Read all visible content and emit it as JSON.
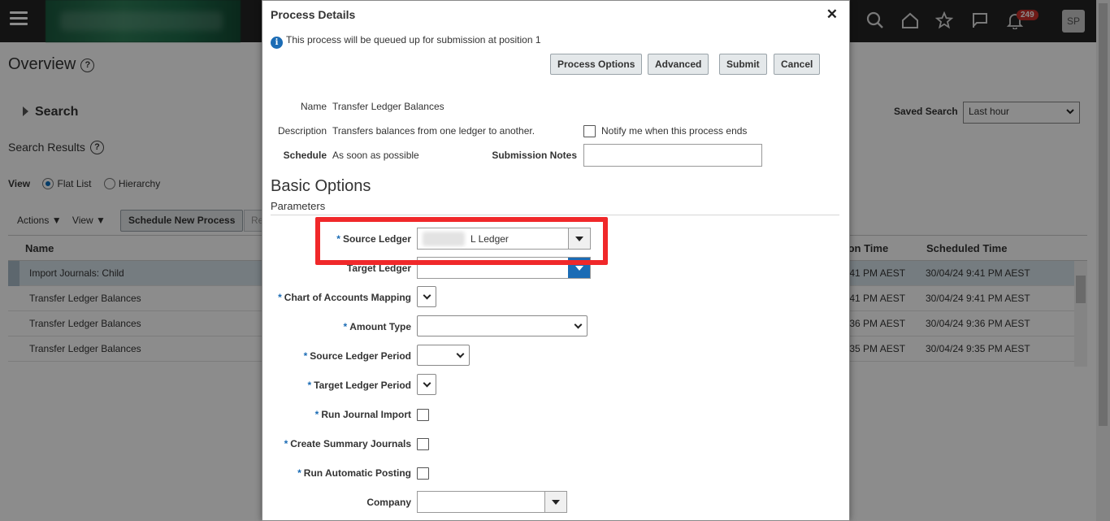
{
  "background": {
    "page_title": "Overview",
    "search_label": "Search",
    "search_results_label": "Search Results",
    "saved_search_label": "Saved Search",
    "saved_search_value": "Last hour",
    "view_label": "View",
    "view_options": [
      "Flat List",
      "Hierarchy"
    ],
    "actions_menu": "Actions",
    "view_menu": "View",
    "schedule_button": "Schedule New Process",
    "truncated_button": "Re",
    "notification_count": "249",
    "avatar_initials": "SP",
    "grid": {
      "columns": [
        "Name",
        "ion Time",
        "Scheduled Time"
      ],
      "rows": [
        {
          "name": "Import Journals: Child",
          "time": ":41 PM AEST",
          "scheduled": "30/04/24 9:41 PM AEST"
        },
        {
          "name": "Transfer Ledger Balances",
          "time": ":41 PM AEST",
          "scheduled": "30/04/24 9:41 PM AEST"
        },
        {
          "name": "Transfer Ledger Balances",
          "time": ":36 PM AEST",
          "scheduled": "30/04/24 9:36 PM AEST"
        },
        {
          "name": "Transfer Ledger Balances",
          "time": ":35 PM AEST",
          "scheduled": "30/04/24 9:35 PM AEST"
        }
      ]
    }
  },
  "dialog": {
    "title": "Process Details",
    "info": "This process will be queued up for submission at position 1",
    "buttons": {
      "process_options": "Process Options",
      "advanced": "Advanced",
      "submit": "Submit",
      "cancel": "Cancel"
    },
    "name_label": "Name",
    "name_value": "Transfer Ledger Balances",
    "description_label": "Description",
    "description_value": "Transfers balances from one ledger to another.",
    "schedule_label": "Schedule",
    "schedule_value": "As soon as possible",
    "notify_label": "Notify me when this process ends",
    "submission_notes_label": "Submission Notes",
    "basic_options": "Basic Options",
    "parameters": "Parameters",
    "required_marker": "*",
    "fields": {
      "source_ledger": {
        "label": "Source Ledger",
        "value": "L Ledger"
      },
      "target_ledger": {
        "label": "Target Ledger"
      },
      "coa_mapping": {
        "label": "Chart of Accounts Mapping"
      },
      "amount_type": {
        "label": "Amount Type"
      },
      "source_period": {
        "label": "Source Ledger Period"
      },
      "target_period": {
        "label": "Target Ledger Period"
      },
      "run_journal_import": {
        "label": "Run Journal Import"
      },
      "create_summary": {
        "label": "Create Summary Journals"
      },
      "run_auto_posting": {
        "label": "Run Automatic Posting"
      },
      "company": {
        "label": "Company"
      }
    }
  },
  "colors": {
    "highlight": "#f0282a",
    "accent": "#1b6cb5",
    "header_bg": "#232323"
  }
}
